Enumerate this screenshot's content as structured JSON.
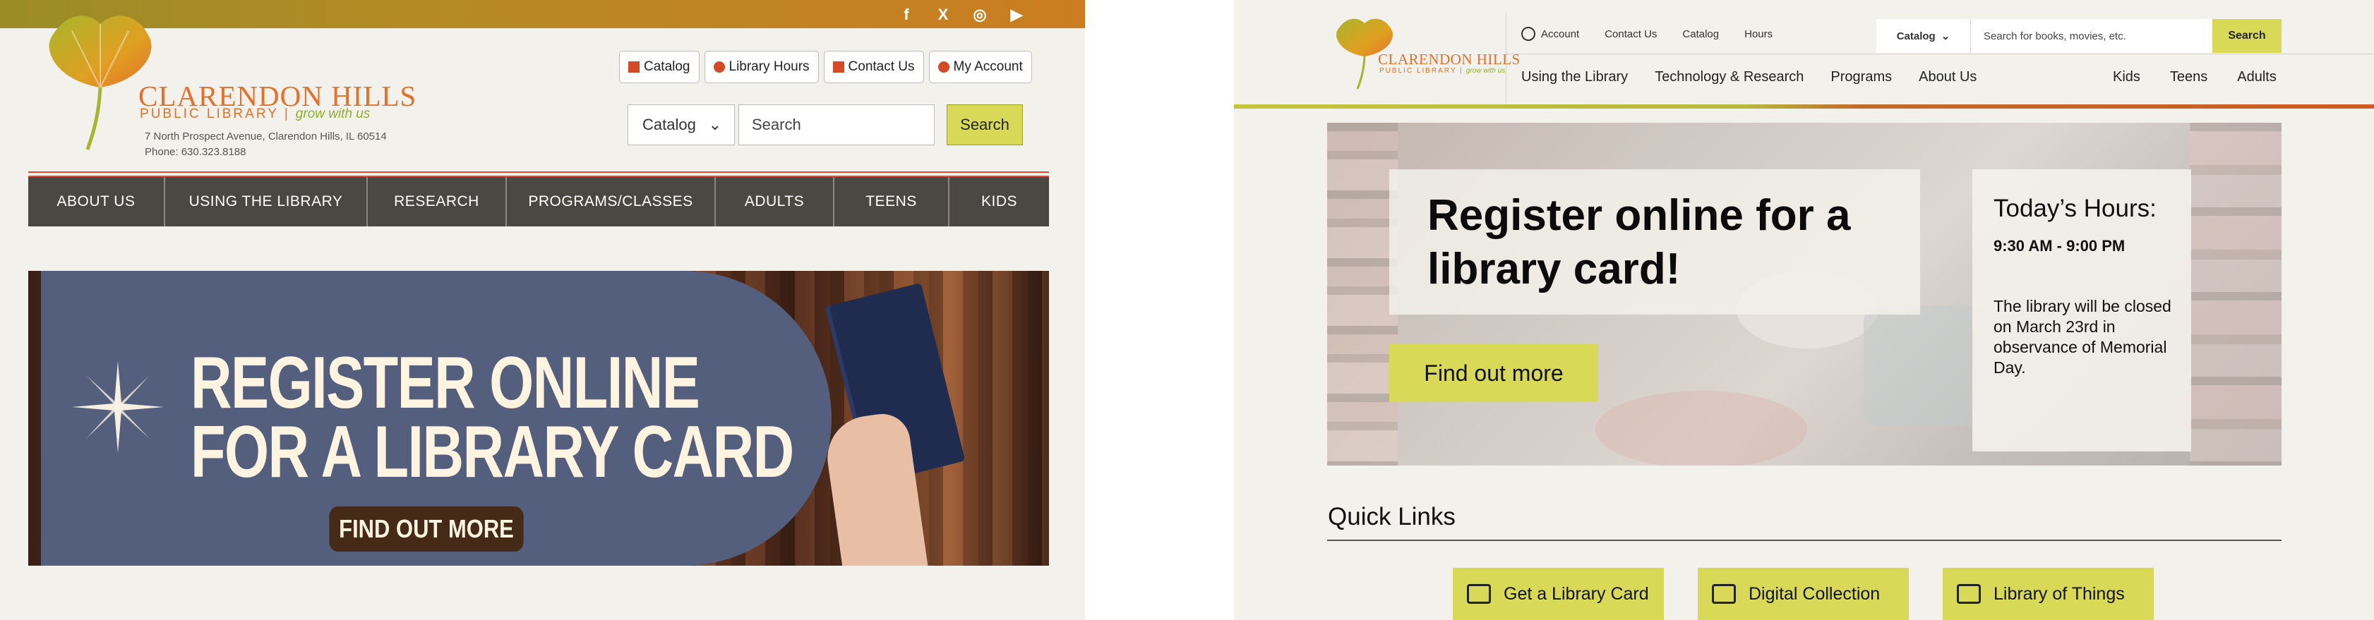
{
  "old_site": {
    "social": [
      "f",
      "X",
      "◎",
      "▶"
    ],
    "brand": {
      "name": "CLARENDON HILLS",
      "sub": "PUBLIC LIBRARY",
      "tagline": "grow with us"
    },
    "address": "7 North Prospect Avenue, Clarendon Hills, IL 60514",
    "phone": "Phone: 630.323.8188",
    "util_buttons": [
      "Catalog",
      "Library Hours",
      "Contact Us",
      "My Account"
    ],
    "search": {
      "select": "Catalog",
      "placeholder": "Search",
      "button": "Search"
    },
    "nav": [
      "ABOUT US",
      "USING THE LIBRARY",
      "RESEARCH",
      "PROGRAMS/CLASSES",
      "ADULTS",
      "TEENS",
      "KIDS"
    ],
    "banner": {
      "line1": "REGISTER ONLINE",
      "line2": "FOR A LIBRARY CARD",
      "button": "FIND OUT MORE"
    }
  },
  "new_site": {
    "brand": {
      "name": "CLARENDON HILLS",
      "sub": "PUBLIC LIBRARY",
      "tagline": "grow with us"
    },
    "util": {
      "account": "Account",
      "contact": "Contact Us",
      "catalog": "Catalog",
      "hours": "Hours"
    },
    "search": {
      "select": "Catalog",
      "placeholder": "Search for books, movies, etc.",
      "button": "Search"
    },
    "main_nav": [
      "Using the Library",
      "Technology & Research",
      "Programs",
      "About Us"
    ],
    "audience_nav": [
      "Kids",
      "Teens",
      "Adults"
    ],
    "hero": {
      "title": "Register online for a library card!",
      "button": "Find out more",
      "hours_title": "Today’s Hours:",
      "hours_time": "9:30 AM - 9:00 PM",
      "notice": "The library will be closed on March 23rd in observance of Memorial Day."
    },
    "quick_links": {
      "heading": "Quick Links",
      "items": [
        "Get a Library Card",
        "Digital Collection",
        "Library of Things"
      ]
    }
  },
  "colors": {
    "accent_green": "#d8da57",
    "brand_orange": "#e3712a",
    "nav_dark": "#4b4843"
  }
}
